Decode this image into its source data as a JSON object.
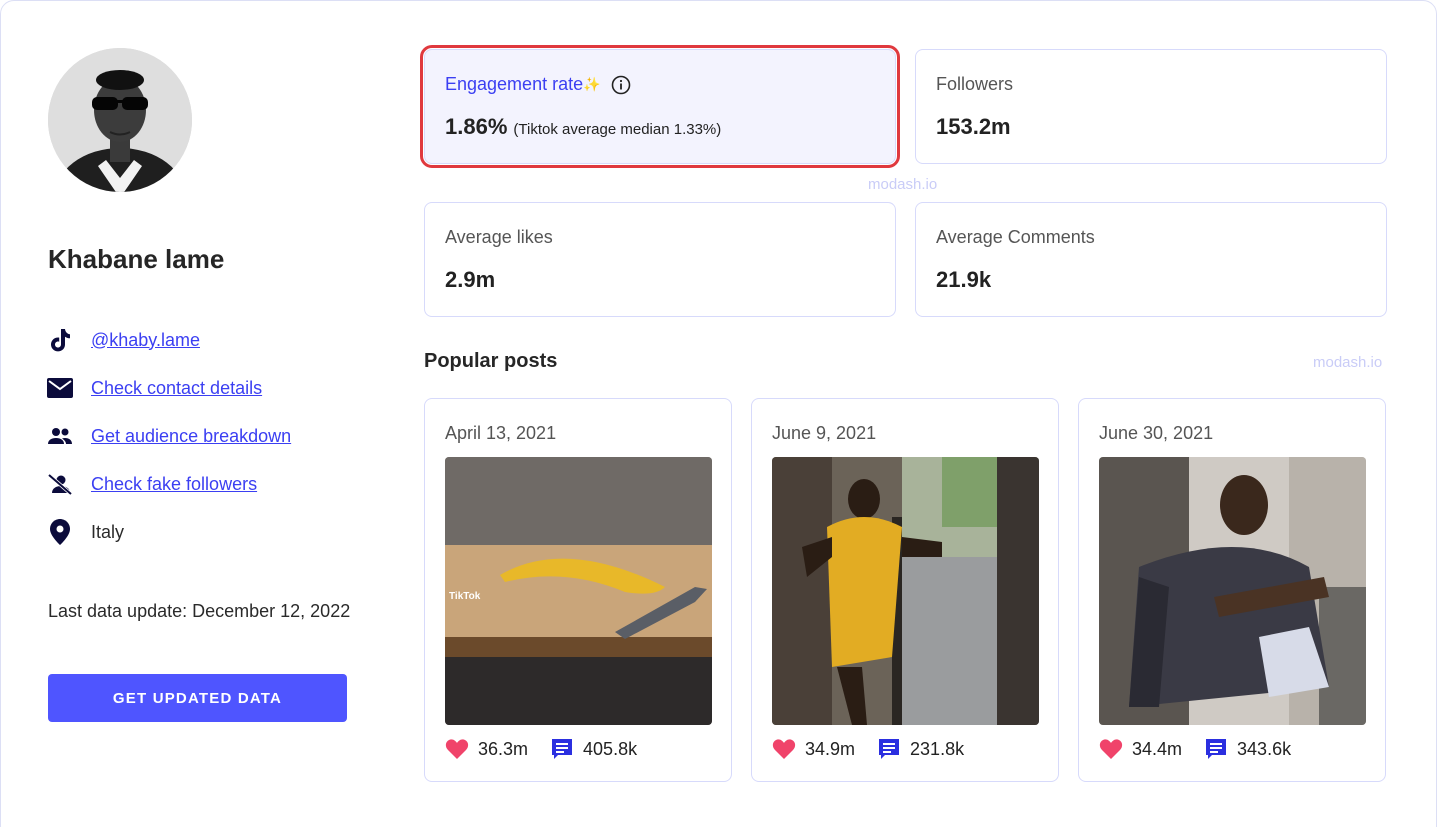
{
  "profile": {
    "name": "Khabane lame",
    "links": [
      {
        "label": "@khaby.lame",
        "icon": "tiktok-icon"
      },
      {
        "label": "Check contact details",
        "icon": "mail-icon"
      },
      {
        "label": "Get audience breakdown",
        "icon": "people-icon"
      },
      {
        "label": "Check fake followers",
        "icon": "fake-followers-icon"
      }
    ],
    "location": {
      "label": "Italy",
      "icon": "location-pin-icon"
    },
    "last_update": "Last data update: December 12, 2022",
    "cta_label": "GET UPDATED DATA"
  },
  "stats": {
    "engagement": {
      "label": "Engagement rate",
      "sparkle": "✨",
      "value": "1.86%",
      "note": "(Tiktok average median 1.33%)"
    },
    "followers": {
      "label": "Followers",
      "value": "153.2m"
    },
    "avg_likes": {
      "label": "Average likes",
      "value": "2.9m"
    },
    "avg_comments": {
      "label": "Average Comments",
      "value": "21.9k"
    }
  },
  "watermark": "modash.io",
  "popular_posts": {
    "title": "Popular posts",
    "posts": [
      {
        "date": "April 13, 2021",
        "likes": "36.3m",
        "comments": "405.8k",
        "overlay": "TikTok"
      },
      {
        "date": "June 9, 2021",
        "likes": "34.9m",
        "comments": "231.8k"
      },
      {
        "date": "June 30, 2021",
        "likes": "34.4m",
        "comments": "343.6k"
      }
    ]
  },
  "colors": {
    "accent": "#4f55ff",
    "link": "#3b3ff2",
    "highlight_border": "#e0393e",
    "heart": "#f0436a",
    "comment": "#2b2fe0"
  }
}
